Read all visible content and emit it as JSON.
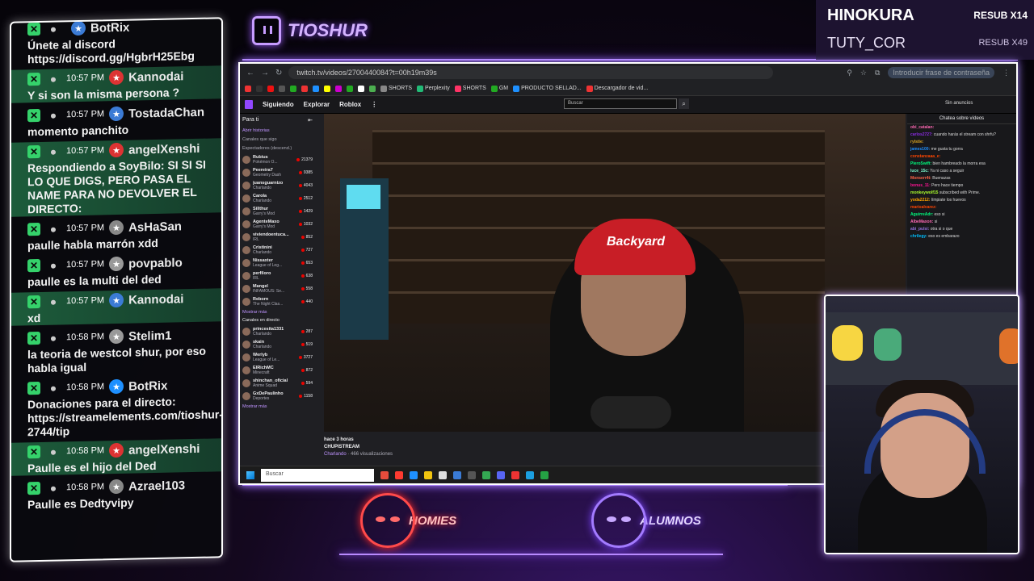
{
  "brand": {
    "name": "TIOSHUR"
  },
  "subs": [
    {
      "name": "HINOKURA",
      "tag": "RESUB X14"
    },
    {
      "name": "TUTY_COR",
      "tag": "RESUB X49"
    }
  ],
  "chat": [
    {
      "time": "",
      "user": "BotRix",
      "text": "Únete al discord https://discord.gg/HgbrH25Ebg",
      "hl": false
    },
    {
      "time": "10:57 PM",
      "user": "Kannodai",
      "text": "Y si son la misma persona ?",
      "hl": true
    },
    {
      "time": "10:57 PM",
      "user": "TostadaChan",
      "text": "momento panchito",
      "hl": false
    },
    {
      "time": "10:57 PM",
      "user": "angelXenshi",
      "text": "Respondiendo a SoyBilo: SI SI SI LO QUE DIGS, PERO PASA EL NAME PARA NO DEVOLVER EL DIRECTO:",
      "hl": true
    },
    {
      "time": "10:57 PM",
      "user": "AsHaSan",
      "text": "paulle habla marrón xdd",
      "hl": false
    },
    {
      "time": "10:57 PM",
      "user": "povpablo",
      "text": "paulle es la multi del ded",
      "hl": false
    },
    {
      "time": "10:57 PM",
      "user": "Kannodai",
      "text": "xd",
      "hl": true
    },
    {
      "time": "10:58 PM",
      "user": "Stelim1",
      "text": "la teoria de westcol shur, por eso habla igual",
      "hl": false
    },
    {
      "time": "10:58 PM",
      "user": "BotRix",
      "text": "Donaciones para el directo: https://streamelements.com/tioshur-2744/tip",
      "hl": false
    },
    {
      "time": "10:58 PM",
      "user": "angelXenshi",
      "text": "Paulle es el hijo del Ded",
      "hl": true
    },
    {
      "time": "10:58 PM",
      "user": "Azrael103",
      "text": "Paulle es Dedtyvipy",
      "hl": false
    }
  ],
  "browser": {
    "url": "twitch.tv/videos/2700440084?t=00h19m39s",
    "password_btn": "Introducir frase de contraseña",
    "bookmarks": [
      "SHORTS",
      "Perplexity",
      "SHORTS",
      "GM",
      "PRODUCTO SELLAD...",
      "Descargador de vid..."
    ],
    "nav": [
      "Siguiendo",
      "Explorar",
      "Roblox"
    ],
    "search_placeholder": "Buscar",
    "ad_free": "Sin anuncios",
    "sidebar": {
      "title": "Para ti",
      "stories": "Abrir historias",
      "followed_title": "Canales que sigo",
      "followed_sub": "Espectadores (descend.)",
      "followed": [
        {
          "name": "Rubius",
          "game": "Pokémon O...",
          "viewers": "21379"
        },
        {
          "name": "Peereira7",
          "game": "Geometry Dash",
          "viewers": "9385"
        },
        {
          "name": "juansguarnizo",
          "game": "Charlando",
          "viewers": "4043"
        },
        {
          "name": "Carola",
          "game": "Charlando",
          "viewers": "2512"
        },
        {
          "name": "Sillthur",
          "game": "Garry's Mod",
          "viewers": "1429"
        },
        {
          "name": "AgenteMaxo",
          "game": "Garry's Mod",
          "viewers": "1032"
        },
        {
          "name": "viviendoentuca...",
          "game": "IRL",
          "viewers": "852"
        },
        {
          "name": "Cristinini",
          "game": "Charlando",
          "viewers": "727"
        },
        {
          "name": "Nissaxter",
          "game": "League of Leg...",
          "viewers": "653"
        },
        {
          "name": "perfiloro",
          "game": "IRL",
          "viewers": "638"
        },
        {
          "name": "Mangel",
          "game": "INFAMOUS: Se...",
          "viewers": "558"
        },
        {
          "name": "Reborn",
          "game": "The Night Clas...",
          "viewers": "440"
        }
      ],
      "more1": "Mostrar más",
      "live_title": "Canales en directo",
      "live": [
        {
          "name": "princesita1331",
          "game": "Charlando",
          "viewers": "287"
        },
        {
          "name": "skain",
          "game": "Charlando",
          "viewers": "519"
        },
        {
          "name": "Werlyb",
          "game": "League of Le...",
          "viewers": "3727"
        },
        {
          "name": "ElRichMC",
          "game": "Minecraft",
          "viewers": "872"
        },
        {
          "name": "shinchan_oficial",
          "game": "Anime Squad",
          "viewers": "594"
        },
        {
          "name": "GxDePaulinho",
          "game": "Deportes",
          "viewers": "1158"
        }
      ],
      "more2": "Mostrar más"
    },
    "video_info": {
      "ago": "hace 3 horas",
      "title": "CHUPISTREAM",
      "category": "Charlando",
      "views": "· 466 visualizaciones"
    },
    "chat_header": "Chatea sobre vídeos",
    "chat": [
      {
        "user": "obi_catalan:",
        "text": ""
      },
      {
        "user": "carlos2727:",
        "text": "cuando harás el stream con shrfu?"
      },
      {
        "user": "rylstie:",
        "text": ""
      },
      {
        "user": "james100:",
        "text": "me gusta tu gorra"
      },
      {
        "user": "constanzaaa_e:",
        "text": ""
      },
      {
        "user": "PieroSwift:",
        "text": "bien hambreado la morra esa"
      },
      {
        "user": "luce_15c:",
        "text": "Ya ni caso a seguir"
      },
      {
        "user": "Monserr4t:",
        "text": "Buenazas"
      },
      {
        "user": "bonus_11:",
        "text": "Pero hace tiempo"
      },
      {
        "user": "monkeywolf15",
        "text": "subscribed with Prime."
      },
      {
        "user": "yoda2212:",
        "text": "límpiate los huevos"
      },
      {
        "user": "marioalvarez:",
        "text": ""
      },
      {
        "user": "AguirreAdr:",
        "text": "eso si"
      },
      {
        "user": "AlbeMaxon:",
        "text": "si"
      },
      {
        "user": "abi_pulsi:",
        "text": "otra si o que"
      },
      {
        "user": "chrilegy:",
        "text": "eso es embarazo"
      }
    ],
    "taskbar_search": "Buscar"
  },
  "teams": [
    {
      "label": "HOMIES"
    },
    {
      "label": "ALUMNOS"
    }
  ]
}
